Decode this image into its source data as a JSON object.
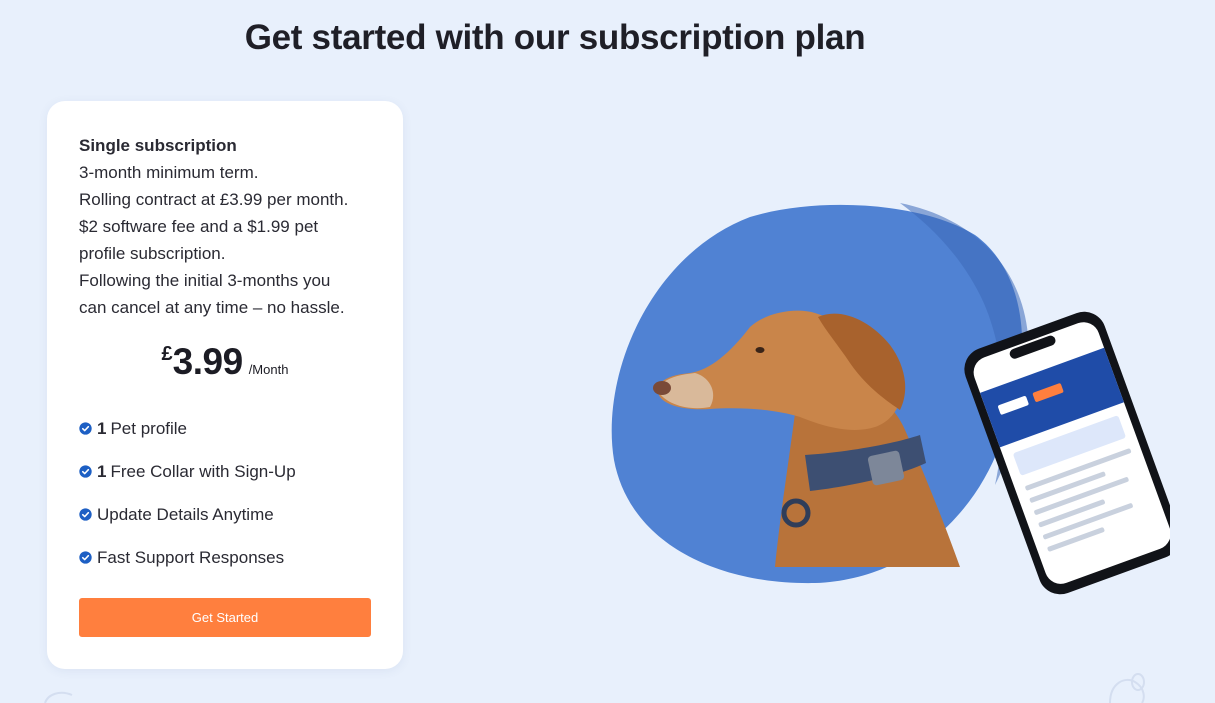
{
  "heading": "Get started with our subscription plan",
  "plan": {
    "name": "Single subscription",
    "description_lines": [
      "3-month minimum term.",
      "Rolling contract at £3.99 per month.",
      "$2 software fee and a $1.99 pet",
      "profile subscription.",
      "Following the initial 3-months you",
      "can cancel at any time – no hassle."
    ],
    "currency": "£",
    "price": "3.99",
    "period": "/Month",
    "features": [
      {
        "count": "1",
        "text": "Pet profile"
      },
      {
        "count": "1",
        "text": "Free Collar with Sign-Up"
      },
      {
        "count": "",
        "text": "Update Details Anytime"
      },
      {
        "count": "",
        "text": "Fast Support Responses"
      }
    ],
    "cta_label": "Get Started"
  },
  "icons": {
    "feature_check": "check-badge-icon"
  },
  "colors": {
    "background": "#e8f0fc",
    "card": "#ffffff",
    "cta": "#ff7f3e",
    "check": "#1d5fc4",
    "blob": "#5082d3"
  }
}
